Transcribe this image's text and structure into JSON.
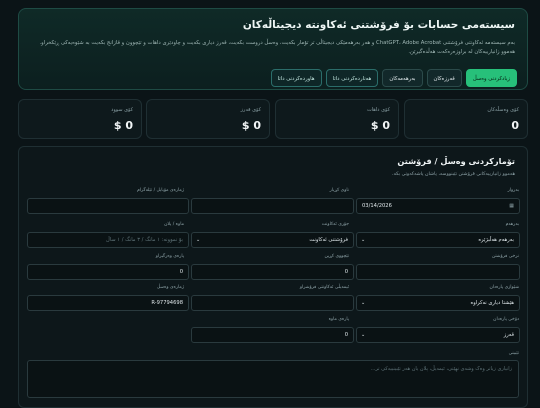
{
  "hero": {
    "title": "سیستەمی حسابات بۆ فرۆشتنی ئەکاونتە دیجیتاڵەکان",
    "description": "بەم سیستەمە ئەکاونتی فرۆشتنی ChatGPT، Adobe Acrobat و هەر بەرهەمێکی دیجیتاڵی تر تۆمار بکەیت، وەسڵ دروست بکەیت، قەرز دیاری بکەیت و چاودێری داهات و تێچوون و قازانج بکەیت بە شێوەیەکی ڕێکخراو. هەموو زانیارییەکان لە براوزەرەکەت هەڵدەگیرێن.",
    "buttons": {
      "new_receipt": "زیادکردنی وەسڵ",
      "debts": "قەرزەکان",
      "products": "بەرهەمەکان",
      "export": "هەناردەکردنی داتا",
      "import": "هاوردەکردنی داتا"
    }
  },
  "stats": [
    {
      "label": "کۆی وەسڵەکان",
      "value": "0"
    },
    {
      "label": "کۆی داهات",
      "value": "$ 0"
    },
    {
      "label": "کۆی قەرز",
      "value": "$ 0"
    },
    {
      "label": "کۆی سوود",
      "value": "$ 0"
    }
  ],
  "form": {
    "title": "تۆمارکردنی وەسڵ / فرۆشتن",
    "subtitle": "هەموو زانیارییەکانی فرۆشتن تێبنووسە، پاشان پاشەکەوتی بکە.",
    "date": {
      "label": "بەروار",
      "value": "03/14/2026"
    },
    "customer": {
      "label": "ناوی کڕیار",
      "placeholder": ""
    },
    "phone": {
      "label": "ژمارەی مۆبایل / تێلەگرام",
      "placeholder": ""
    },
    "product": {
      "label": "بەرهەم",
      "value": "بەرهەم هەڵبژێرە"
    },
    "account_type": {
      "label": "جۆری ئەکاونت",
      "value": "فرۆشتنی ئەکاونت"
    },
    "duration": {
      "label": "ماوە / پلان",
      "placeholder": "بۆ نموونە: ١ مانگ / ٣ مانگ / ١ ساڵ"
    },
    "sale_price": {
      "label": "نرخی فرۆشتن",
      "value": ""
    },
    "cost": {
      "label": "تێچووی کڕین",
      "value": "0"
    },
    "paid": {
      "label": "پارەی وەرگیراو",
      "value": "0"
    },
    "payment_status": {
      "label": "دۆخی پارەدان",
      "value": "قەرز"
    },
    "account_email": {
      "label": "ئیمەیڵی ئەکاونتی فرۆشراو",
      "value": ""
    },
    "receipt_no": {
      "label": "ژمارەی وەسڵ",
      "value": "R-97794698"
    },
    "payment_method": {
      "label": "شێوازی پارەدان",
      "value": "هێشتا دیاری نەکراوە"
    },
    "remaining": {
      "label": "پارەی ماوە",
      "value": "0"
    },
    "notes": {
      "label": "تێبینی",
      "placeholder": "زانیاری زیاتر وەک وشەی نهێنی، ئیمەیڵ، پلان یان هەر تێبینییەکی تر..."
    }
  }
}
